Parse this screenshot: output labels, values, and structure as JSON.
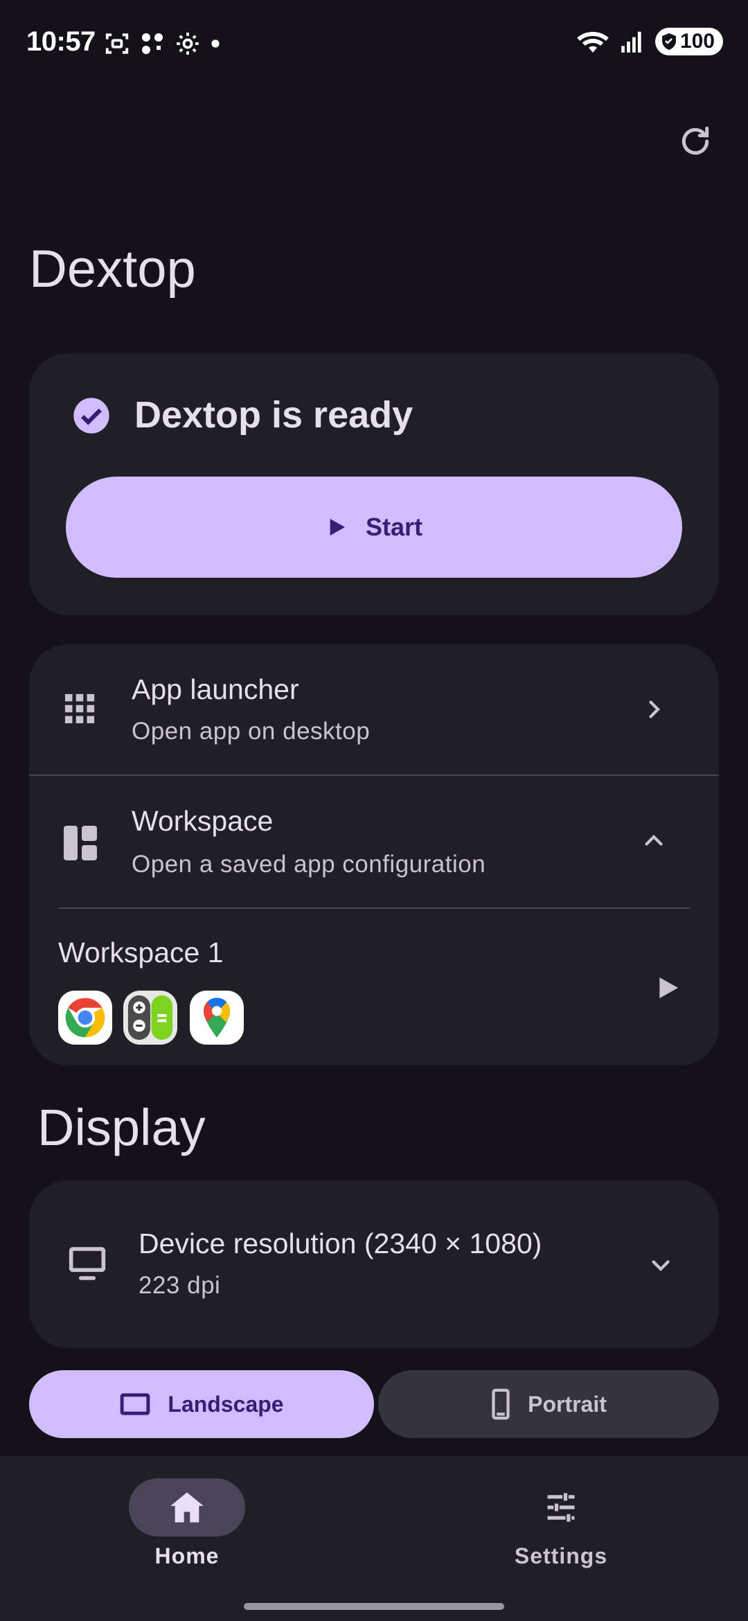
{
  "status": {
    "time": "10:57",
    "battery": "100"
  },
  "app": {
    "title": "Dextop"
  },
  "ready_card": {
    "status_text": "Dextop is ready",
    "start_label": "Start"
  },
  "launcher": {
    "title": "App launcher",
    "subtitle": "Open app on desktop"
  },
  "workspace": {
    "title": "Workspace",
    "subtitle": "Open a saved app configuration",
    "items": [
      {
        "name": "Workspace 1",
        "apps": [
          "chrome-icon",
          "calculator-icon",
          "maps-icon"
        ]
      }
    ]
  },
  "display": {
    "section_title": "Display",
    "resolution_title": "Device resolution (2340 × 1080)",
    "dpi": "223 dpi",
    "orientation": {
      "landscape_label": "Landscape",
      "portrait_label": "Portrait",
      "selected": "Landscape"
    }
  },
  "nav": {
    "home_label": "Home",
    "settings_label": "Settings",
    "selected": "Home"
  },
  "colors": {
    "accent": "#d0bcff",
    "background": "#141218",
    "surface": "#211f26",
    "on_accent": "#381e72"
  }
}
